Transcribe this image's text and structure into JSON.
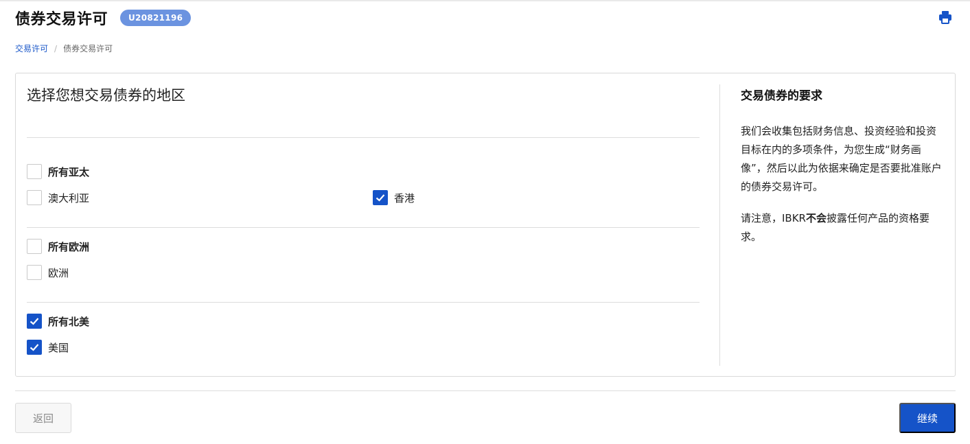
{
  "header": {
    "title": "债券交易许可",
    "account_id": "U20821196"
  },
  "breadcrumb": {
    "root": "交易许可",
    "separator": "/",
    "current": "债券交易许可"
  },
  "regions": {
    "heading": "选择您想交易债券的地区",
    "apac": {
      "all_label": "所有亚太",
      "all_checked": false,
      "items": [
        {
          "label": "澳大利亚",
          "checked": false
        },
        {
          "label": "香港",
          "checked": true
        }
      ]
    },
    "europe": {
      "all_label": "所有欧洲",
      "all_checked": false,
      "items": [
        {
          "label": "欧洲",
          "checked": false
        }
      ]
    },
    "north_america": {
      "all_label": "所有北美",
      "all_checked": true,
      "items": [
        {
          "label": "美国",
          "checked": true
        }
      ]
    }
  },
  "sidebar": {
    "title": "交易债券的要求",
    "paragraph1": "我们会收集包括财务信息、投资经验和投资目标在内的多项条件，为您生成“财务画像”，然后以此为依据来确定是否要批准账户的债券交易许可。",
    "p2_prefix": "请注意，IBKR",
    "p2_bold": "不会",
    "p2_suffix": "披露任何产品的资格要求。"
  },
  "footer": {
    "back_label": "返回",
    "continue_label": "继续"
  },
  "colors": {
    "accent": "#1553c8",
    "badge": "#6b93e0"
  },
  "icons": {
    "print": "printer-icon",
    "check": "checkmark-icon"
  }
}
